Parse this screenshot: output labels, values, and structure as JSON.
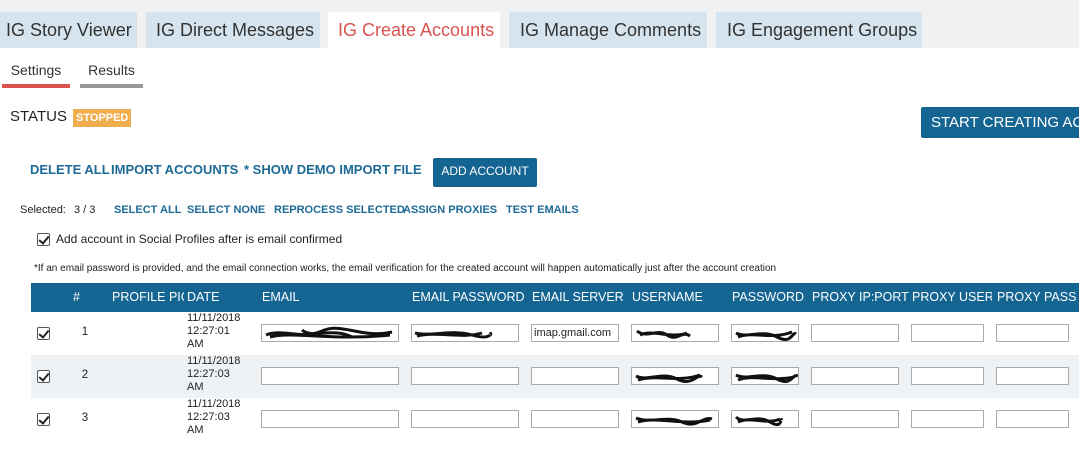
{
  "tabs": [
    {
      "label": "IG Story Viewer",
      "active": false
    },
    {
      "label": "IG Direct Messages",
      "active": false
    },
    {
      "label": "IG Create Accounts",
      "active": true
    },
    {
      "label": "IG Manage Comments",
      "active": false
    },
    {
      "label": "IG Engagement Groups",
      "active": false
    }
  ],
  "subtabs": [
    {
      "label": "Settings",
      "active": true
    },
    {
      "label": "Results",
      "active": false
    }
  ],
  "status": {
    "label": "STATUS",
    "value": "STOPPED",
    "badge_color": "#f0ad4e"
  },
  "start_button": "START CREATING ACCOUNTS",
  "actions": {
    "delete_all": "DELETE ALL",
    "import_accounts": "IMPORT ACCOUNTS",
    "show_demo": "* SHOW DEMO IMPORT FILE",
    "add_account": "ADD ACCOUNT"
  },
  "selection": {
    "label": "Selected:",
    "count": "3 / 3",
    "select_all": "SELECT ALL",
    "select_none": "SELECT NONE",
    "reprocess": "REPROCESS SELECTED",
    "assign_proxies": "ASSIGN PROXIES",
    "test_emails": "TEST EMAILS"
  },
  "confirm_option": {
    "label": "Add account in Social Profiles after is email confirmed",
    "checked": true
  },
  "note": "*If an email password is provided, and the email connection works, the email verification for the created account will happen automatically just after the account creation",
  "table": {
    "headers": [
      "#",
      "PROFILE PIC",
      "DATE",
      "EMAIL",
      "EMAIL PASSWORD",
      "EMAIL SERVER",
      "USERNAME",
      "PASSWORD",
      "PROXY IP:PORT",
      "PROXY USERNAME",
      "PROXY PASS"
    ],
    "rows": [
      {
        "checked": true,
        "num": "1",
        "date": "11/11/2018",
        "time": "12:27:01",
        "ampm": "AM",
        "email_server": "imap.gmail.com"
      },
      {
        "checked": true,
        "num": "2",
        "date": "11/11/2018",
        "time": "12:27:03",
        "ampm": "AM",
        "email_server": ""
      },
      {
        "checked": true,
        "num": "3",
        "date": "11/11/2018",
        "time": "12:27:03",
        "ampm": "AM",
        "email_server": ""
      }
    ]
  },
  "colors": {
    "primary": "#156593",
    "link": "#1d6a97",
    "active_tab_text": "#d9534f",
    "tab_bg": "#d5e4ee"
  }
}
